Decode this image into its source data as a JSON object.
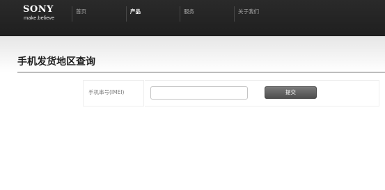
{
  "header": {
    "brand": {
      "name": "SONY",
      "tagline": "make.believe"
    },
    "nav": [
      {
        "label": "首页"
      },
      {
        "label": "产品",
        "active": true
      },
      {
        "label": "服务"
      },
      {
        "label": "关于我们"
      }
    ]
  },
  "page": {
    "title": "手机发货地区查询"
  },
  "form": {
    "imei_label": "手机串号(IMEI)",
    "imei_value": "",
    "submit_label": "提交"
  },
  "colors": {
    "header_bg": "#222222",
    "accent_button": "#5e5e5e",
    "title_rule": "#bdbdbd"
  }
}
